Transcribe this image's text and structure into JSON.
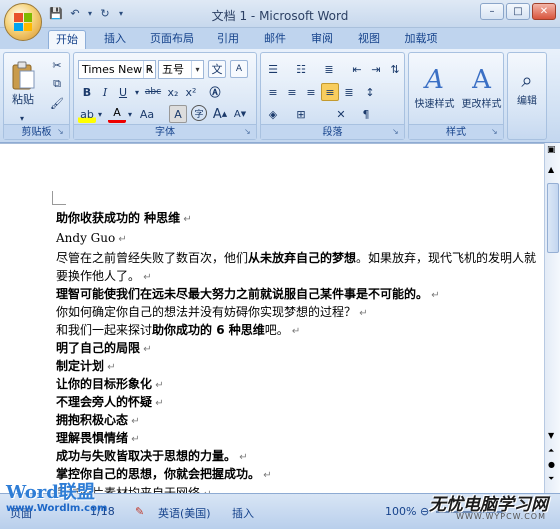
{
  "window": {
    "title": "文档 1 - Microsoft Word"
  },
  "qat": {
    "save": "💾",
    "undo": "↶",
    "redo": "↻"
  },
  "tabs": [
    "开始",
    "插入",
    "页面布局",
    "引用",
    "邮件",
    "审阅",
    "视图",
    "加载项"
  ],
  "ribbon": {
    "clipboard": {
      "label": "剪贴板",
      "paste": "粘贴"
    },
    "font": {
      "label": "字体",
      "font_name": "Times New R",
      "font_size": "五号",
      "bold": "B",
      "italic": "I",
      "underline": "U",
      "strike": "abc",
      "sub": "x₂",
      "sup": "x²",
      "aa": "Aa",
      "grow": "A",
      "shrink": "A",
      "wen": "文",
      "ab": "ab"
    },
    "paragraph": {
      "label": "段落"
    },
    "styles": {
      "label": "样式",
      "quick_styles": "快速样式",
      "change_styles": "更改样式"
    },
    "editing": {
      "label": "编辑"
    }
  },
  "document": {
    "lines": [
      {
        "text": "助你收获成功的            种思维",
        "bold": true
      },
      {
        "text": "Andy Guo",
        "bold": false
      },
      {
        "text": "尽管在之前曾经失败了数百次，他们",
        "bold": false,
        "rest_bold": "从未放弃自己的梦想",
        "rest": "。如果放弃，现代飞机的发明人就"
      },
      {
        "text": "要换作他人了。",
        "bold": false
      },
      {
        "text": "理智可能使我们在远未尽最大努力之前就说服自己某件事是不可能的。",
        "bold": true
      },
      {
        "text": "你如何确定你自己的想法并没有妨碍你实现梦想的过程？",
        "bold": false
      },
      {
        "text": "和我们一起来探讨",
        "bold": false,
        "rest_bold": "助你成功的 6 种思维",
        "rest": "吧。"
      },
      {
        "text": "明了自己的局限",
        "bold": true
      },
      {
        "text": "制定计划",
        "bold": true
      },
      {
        "text": "让你的目标形象化",
        "bold": true
      },
      {
        "text": "不理会旁人的怀疑",
        "bold": true
      },
      {
        "text": "拥抱积极心态",
        "bold": true
      },
      {
        "text": "理解畏惧情绪",
        "bold": true
      },
      {
        "text": "成功与失败皆取决于思想的力量。",
        "bold": true
      },
      {
        "text": "掌控你自己的思想，你就会把握成功。",
        "bold": true
      },
      {
        "text": "所有图片素材均来自于网络",
        "bold": false
      }
    ]
  },
  "status": {
    "page": "页面",
    "lang": "英语(美国)",
    "zoom": "100%",
    "insert": "插入",
    "count": "1/18"
  },
  "watermarks": {
    "left": "Word联盟",
    "left_url": "www.Wordlm.com",
    "right": "无忧电脑学习网",
    "right_url": "WWW.WYPCW.COM"
  }
}
